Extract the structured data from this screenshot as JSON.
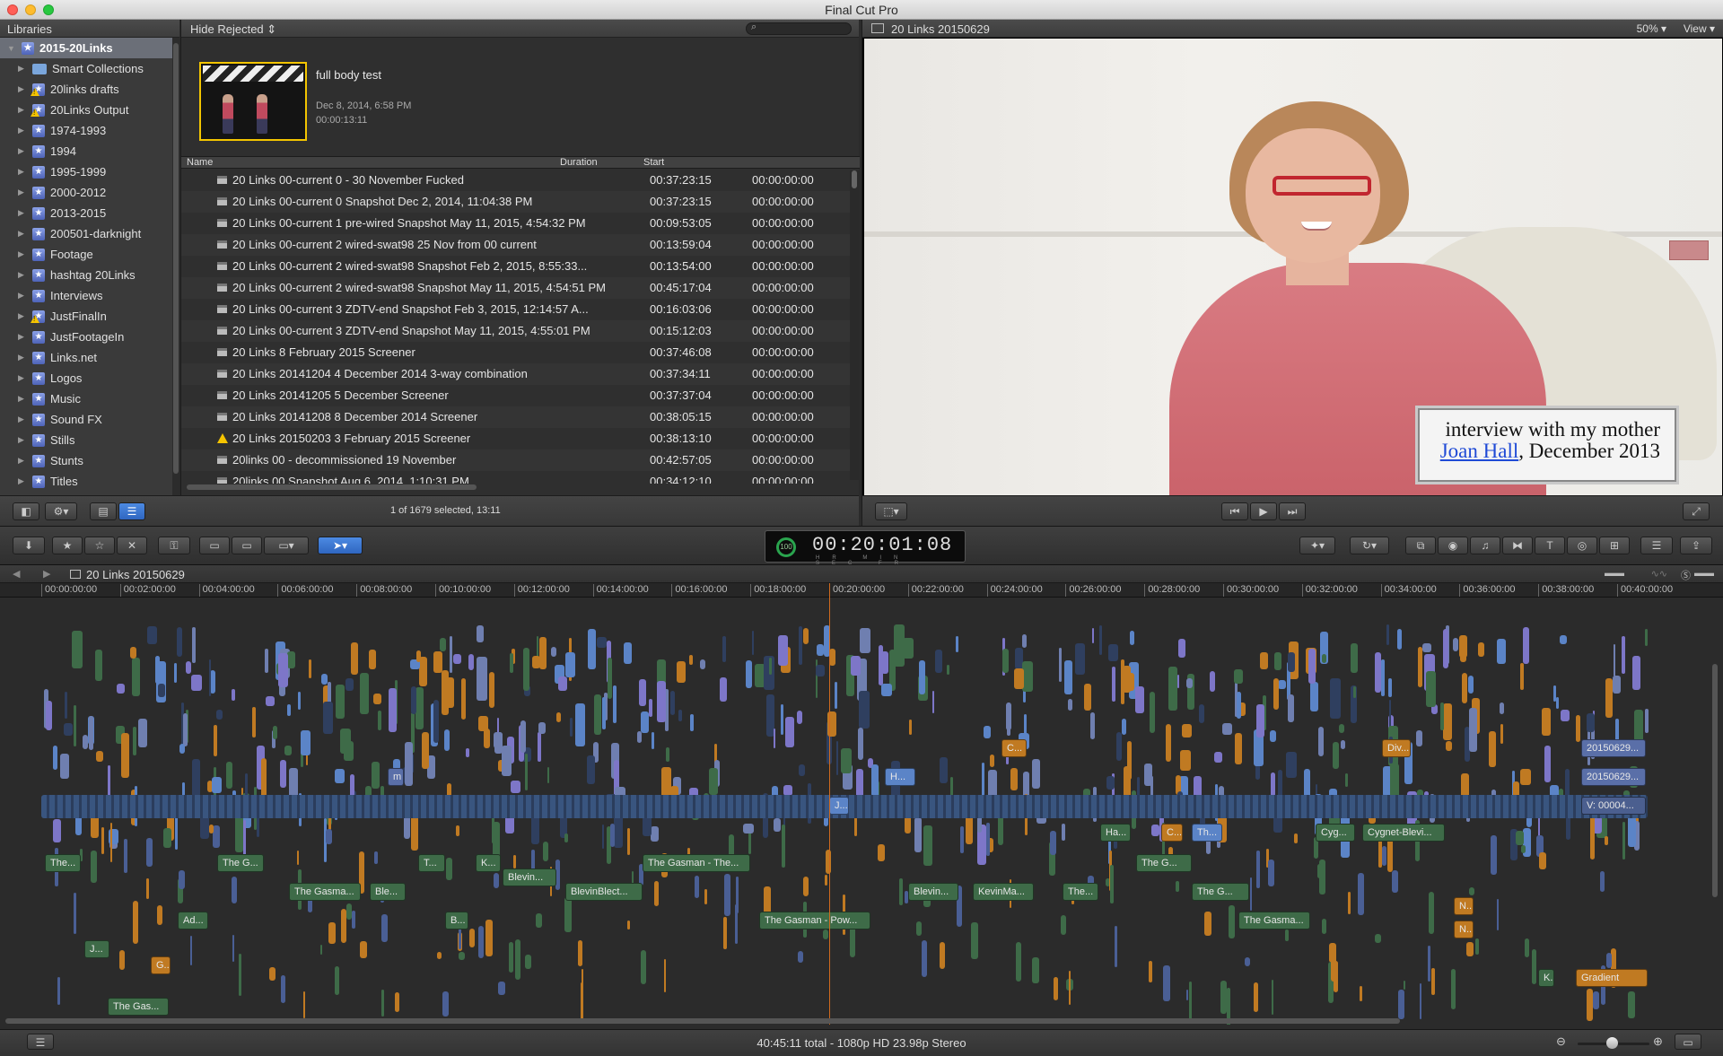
{
  "window": {
    "title": "Final Cut Pro"
  },
  "libraries": {
    "header": "Libraries",
    "items": [
      {
        "label": "2015-20Links",
        "icon": "library-icon",
        "selected": true,
        "root": true
      },
      {
        "label": "Smart Collections",
        "icon": "folder-icon"
      },
      {
        "label": "20links drafts",
        "icon": "event-icon",
        "warn": true
      },
      {
        "label": "20Links Output",
        "icon": "event-icon",
        "warn": true
      },
      {
        "label": "1974-1993",
        "icon": "event-icon"
      },
      {
        "label": "1994",
        "icon": "event-icon"
      },
      {
        "label": "1995-1999",
        "icon": "event-icon"
      },
      {
        "label": "2000-2012",
        "icon": "event-icon"
      },
      {
        "label": "2013-2015",
        "icon": "event-icon"
      },
      {
        "label": "200501-darknight",
        "icon": "event-icon"
      },
      {
        "label": "Footage",
        "icon": "event-icon"
      },
      {
        "label": "hashtag 20Links",
        "icon": "event-icon"
      },
      {
        "label": "Interviews",
        "icon": "event-icon"
      },
      {
        "label": "JustFinalIn",
        "icon": "event-icon",
        "warn": true
      },
      {
        "label": "JustFootageIn",
        "icon": "event-icon"
      },
      {
        "label": "Links.net",
        "icon": "event-icon"
      },
      {
        "label": "Logos",
        "icon": "event-icon"
      },
      {
        "label": "Music",
        "icon": "event-icon"
      },
      {
        "label": "Sound FX",
        "icon": "event-icon"
      },
      {
        "label": "Stills",
        "icon": "event-icon"
      },
      {
        "label": "Stunts",
        "icon": "event-icon"
      },
      {
        "label": "Titles",
        "icon": "event-icon"
      }
    ]
  },
  "browser": {
    "filter_label": "Hide Rejected ⇕",
    "search_icon": "search-icon",
    "clip": {
      "title": "full body test",
      "date": "Dec 8, 2014, 6:58 PM",
      "duration": "00:00:13:11"
    },
    "columns": {
      "name": "Name",
      "duration": "Duration",
      "start": "Start"
    },
    "rows": [
      {
        "name": "20 Links 00-current 0 - 30 November Fucked",
        "duration": "00:37:23:15",
        "start": "00:00:00:00"
      },
      {
        "name": "20 Links 00-current 0 Snapshot Dec 2, 2014, 11:04:38 PM",
        "duration": "00:37:23:15",
        "start": "00:00:00:00"
      },
      {
        "name": "20 Links 00-current 1 pre-wired Snapshot May 11, 2015, 4:54:32 PM",
        "duration": "00:09:53:05",
        "start": "00:00:00:00"
      },
      {
        "name": "20 Links 00-current 2 wired-swat98 25 Nov from 00 current",
        "duration": "00:13:59:04",
        "start": "00:00:00:00"
      },
      {
        "name": "20 Links 00-current 2 wired-swat98 Snapshot Feb 2, 2015, 8:55:33...",
        "duration": "00:13:54:00",
        "start": "00:00:00:00"
      },
      {
        "name": "20 Links 00-current 2 wired-swat98 Snapshot May 11, 2015, 4:54:51 PM",
        "duration": "00:45:17:04",
        "start": "00:00:00:00"
      },
      {
        "name": "20 Links 00-current 3 ZDTV-end Snapshot Feb 3, 2015, 12:14:57 A...",
        "duration": "00:16:03:06",
        "start": "00:00:00:00"
      },
      {
        "name": "20 Links 00-current 3 ZDTV-end Snapshot May 11, 2015, 4:55:01 PM",
        "duration": "00:15:12:03",
        "start": "00:00:00:00"
      },
      {
        "name": "20 Links 8 February 2015 Screener",
        "duration": "00:37:46:08",
        "start": "00:00:00:00"
      },
      {
        "name": "20 Links 20141204 4 December 2014 3-way combination",
        "duration": "00:37:34:11",
        "start": "00:00:00:00"
      },
      {
        "name": "20 Links 20141205 5 December Screener",
        "duration": "00:37:37:04",
        "start": "00:00:00:00"
      },
      {
        "name": "20 Links 20141208 8 December 2014 Screener",
        "duration": "00:38:05:15",
        "start": "00:00:00:00"
      },
      {
        "name": "20 Links 20150203 3 February 2015 Screener",
        "duration": "00:38:13:10",
        "start": "00:00:00:00",
        "warn": true
      },
      {
        "name": "20links 00 - decommissioned 19 November",
        "duration": "00:42:57:05",
        "start": "00:00:00:00"
      },
      {
        "name": "20links 00 Snapshot Aug 6, 2014, 1:10:31 PM",
        "duration": "00:34:12:10",
        "start": "00:00:00:00"
      }
    ],
    "selection_status": "1 of 1679 selected, 13:11"
  },
  "viewer": {
    "title": "20 Links 20150629",
    "zoom": "50% ▾",
    "view_menu": "View ▾",
    "caption_line1": "interview with my mother",
    "caption_link": "Joan Hall",
    "caption_rest": ", December 2013"
  },
  "toolbar": {
    "timecode": "00:20:01:08",
    "timecode_ring": "100",
    "timecode_units": "HR MIN SEC FR"
  },
  "timeline": {
    "project_name": "20 Links 20150629",
    "ruler": [
      "00:00:00:00",
      "00:02:00:00",
      "00:04:00:00",
      "00:06:00:00",
      "00:08:00:00",
      "00:10:00:00",
      "00:12:00:00",
      "00:14:00:00",
      "00:16:00:00",
      "00:18:00:00",
      "00:20:00:00",
      "00:22:00:00",
      "00:24:00:00",
      "00:26:00:00",
      "00:28:00:00",
      "00:30:00:00",
      "00:32:00:00",
      "00:34:00:00",
      "00:36:00:00",
      "00:38:00:00",
      "00:40:00:00"
    ],
    "labels": [
      {
        "text": "The...",
        "color": "#3e6b48"
      },
      {
        "text": "The G...",
        "color": "#3e6b48"
      },
      {
        "text": "The Gasma...",
        "color": "#3e6b48"
      },
      {
        "text": "Ble...",
        "color": "#3e6b48"
      },
      {
        "text": "T...",
        "color": "#3e6b48"
      },
      {
        "text": "K...",
        "color": "#3e6b48"
      },
      {
        "text": "Blevin...",
        "color": "#3e6b48"
      },
      {
        "text": "BlevinBlect...",
        "color": "#3e6b48"
      },
      {
        "text": "The Gasman - The...",
        "color": "#3e6b48"
      },
      {
        "text": "The Gasman - Pow...",
        "color": "#3e6b48"
      },
      {
        "text": "Blevin...",
        "color": "#3e6b48"
      },
      {
        "text": "KevinMa...",
        "color": "#3e6b48"
      },
      {
        "text": "The...",
        "color": "#3e6b48"
      },
      {
        "text": "Ha...",
        "color": "#3e6b48"
      },
      {
        "text": "C...",
        "color": "#c07a22"
      },
      {
        "text": "Th...",
        "color": "#5b84c7"
      },
      {
        "text": "The G...",
        "color": "#3e6b48"
      },
      {
        "text": "The G...",
        "color": "#3e6b48"
      },
      {
        "text": "Cyg...",
        "color": "#3e6b48"
      },
      {
        "text": "Cygnet-Blevi...",
        "color": "#3e6b48"
      },
      {
        "text": "The Gasma...",
        "color": "#3e6b48"
      },
      {
        "text": "Ad...",
        "color": "#3e6b48"
      },
      {
        "text": "J...",
        "color": "#3e6b48"
      },
      {
        "text": "G...",
        "color": "#c07a22"
      },
      {
        "text": "B...",
        "color": "#3e6b48"
      },
      {
        "text": "The Gas...",
        "color": "#3e6b48"
      },
      {
        "text": "N...",
        "color": "#c07a22"
      },
      {
        "text": "N...",
        "color": "#c07a22"
      },
      {
        "text": "K...",
        "color": "#3e6b48"
      },
      {
        "text": "Gradient",
        "color": "#c07a22"
      },
      {
        "text": "20150629...",
        "color": "#5a6fa8"
      },
      {
        "text": "20150629...",
        "color": "#5a6fa8"
      },
      {
        "text": "V: 00004...",
        "color": "#4b5f8f"
      },
      {
        "text": "H...",
        "color": "#5b84c7"
      },
      {
        "text": "J...",
        "color": "#5b84c7"
      },
      {
        "text": "C...",
        "color": "#c07a22"
      },
      {
        "text": "Div...",
        "color": "#c07a22"
      },
      {
        "text": "m",
        "color": "#5a6fa8"
      }
    ]
  },
  "status": {
    "text": "40:45:11 total - 1080p HD 23.98p Stereo"
  },
  "colors": {
    "accent": "#2f66c0",
    "caution": "#f3c500",
    "playhead": "#d06a1e",
    "audio": "#3e6b48",
    "title": "#c07a22",
    "video": "#5b84c7"
  }
}
